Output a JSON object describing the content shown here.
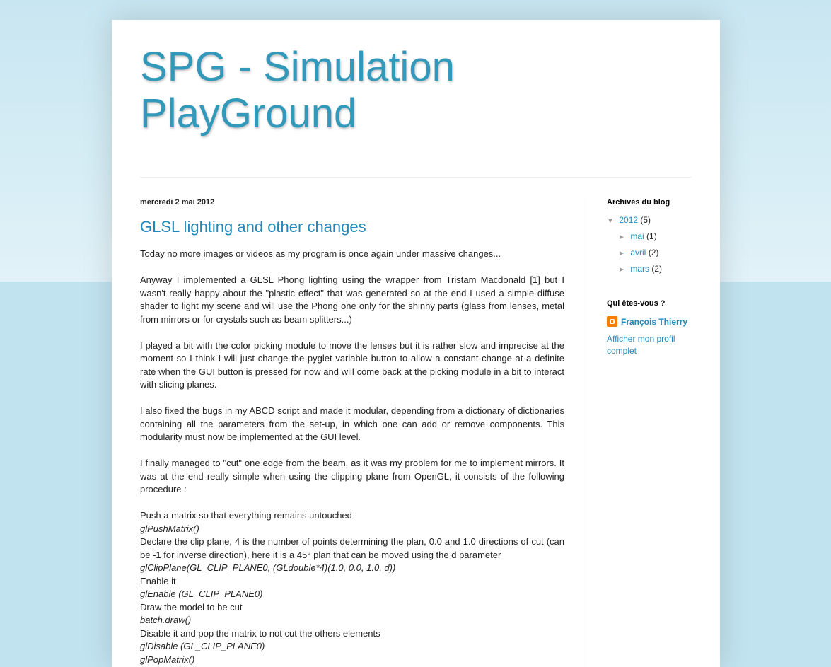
{
  "blog": {
    "title": "SPG - Simulation PlayGround"
  },
  "post": {
    "date": "mercredi 2 mai 2012",
    "title": "GLSL lighting and other changes",
    "paragraphs": [
      "Today no more images or videos as my program is once again under massive changes...",
      "Anyway I implemented a GLSL Phong lighting using the wrapper from Tristam Macdonald [1] but I wasn't really happy about the \"plastic effect\" that was generated so at the end I used a simple diffuse shader to light my scene and will use the Phong one only for the shinny parts (glass from lenses, metal from mirrors or for crystals such as beam splitters...)",
      "I played a bit with the color picking module to move the lenses but it is rather slow and imprecise at the moment so I think I will just change the pyglet variable button to allow a constant change at a definite rate when the GUI button is pressed for now and will come back at the picking module in a bit to interact with slicing planes.",
      "I also fixed the bugs in my ABCD script and made it modular, depending from a dictionary of dictionaries containing all the parameters from the set-up, in which one can add or remove components. This modularity must now be implemented at the GUI level.",
      "I finally managed to \"cut\" one edge from the beam, as it was my problem for me to implement mirrors. It was at the end really simple when using the clipping plane from OpenGL, it consists of the following procedure :"
    ],
    "steps": [
      "Push a matrix so that everything remains untouched",
      "glPushMatrix()",
      "Declare the clip plane, 4 is the number of points determining the plan, 0.0 and 1.0 directions of cut (can be -1 for inverse direction), here it is a 45° plan that can be moved using the d parameter",
      "glClipPlane(GL_CLIP_PLANE0, (GLdouble*4)(1.0, 0.0, 1.0, d))",
      "Enable it",
      "glEnable (GL_CLIP_PLANE0)",
      "Draw the model to be cut",
      "batch.draw()",
      "Disable it  and pop the matrix to not cut the others elements",
      "glDisable (GL_CLIP_PLANE0)",
      "glPopMatrix()"
    ]
  },
  "sidebar": {
    "archive_title": "Archives du blog",
    "year": {
      "toggle": "▼",
      "label": "2012",
      "count": "(5)"
    },
    "months": [
      {
        "toggle": "►",
        "label": "mai",
        "count": "(1)"
      },
      {
        "toggle": "►",
        "label": "avril",
        "count": "(2)"
      },
      {
        "toggle": "►",
        "label": "mars",
        "count": "(2)"
      }
    ],
    "profile_title": "Qui êtes-vous ?",
    "profile_name": "François Thierry",
    "profile_link": "Afficher mon profil complet"
  },
  "colors": {
    "accent": "#2288bb",
    "title": "#3399bb",
    "background": "#c1e3ef",
    "blogger": "#f57d00"
  }
}
